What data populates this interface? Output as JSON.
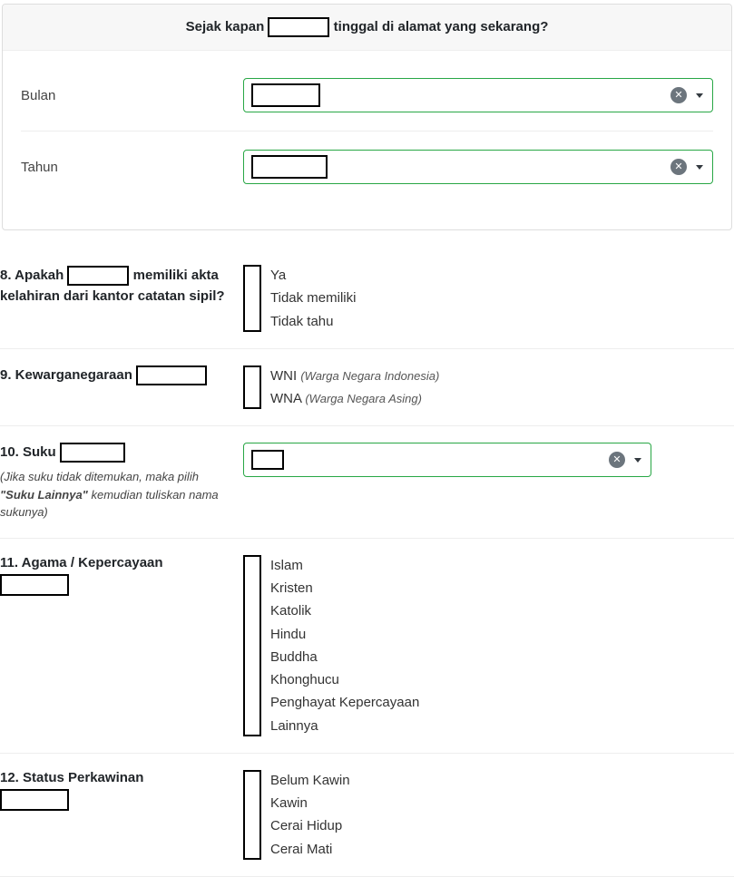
{
  "panel": {
    "header_prefix": "Sejak kapan ",
    "header_suffix": " tinggal di alamat yang sekarang?",
    "fields": {
      "bulan_label": "Bulan",
      "tahun_label": "Tahun"
    }
  },
  "q8": {
    "prefix": "8. Apakah ",
    "suffix": " memiliki akta kelahiran dari kantor catatan sipil?",
    "options": [
      "Ya",
      "Tidak memiliki",
      "Tidak tahu"
    ]
  },
  "q9": {
    "prefix": "9. Kewarganegaraan ",
    "options": [
      {
        "main": "WNI ",
        "paren": "(Warga Negara Indonesia)"
      },
      {
        "main": "WNA ",
        "paren": "(Warga Negara Asing)"
      }
    ]
  },
  "q10": {
    "prefix": "10. Suku ",
    "hint_pre": "(Jika suku tidak ditemukan, maka pilih ",
    "hint_bold": "\"Suku Lainnya\"",
    "hint_post": " kemudian tuliskan nama sukunya)"
  },
  "q11": {
    "label": "11. Agama / Kepercayaan",
    "options": [
      "Islam",
      "Kristen",
      "Katolik",
      "Hindu",
      "Buddha",
      "Khonghucu",
      "Penghayat Kepercayaan",
      "Lainnya"
    ]
  },
  "q12": {
    "label": "12. Status Perkawinan",
    "options": [
      "Belum Kawin",
      "Kawin",
      "Cerai Hidup",
      "Cerai Mati"
    ]
  }
}
